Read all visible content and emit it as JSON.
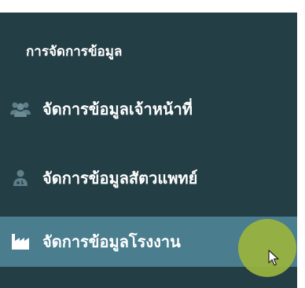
{
  "sidebar": {
    "section_label": "การจัดการข้อมูล",
    "items": [
      {
        "label": "จัดการข้อมูลเจ้าหน้าที่",
        "icon": "users-icon",
        "active": false
      },
      {
        "label": "จัดการข้อมูลสัตวแพทย์",
        "icon": "user-md-icon",
        "active": false
      },
      {
        "label": "จัดการข้อมูลโรงงาน",
        "icon": "factory-icon",
        "active": true
      }
    ]
  },
  "colors": {
    "sidebar_bg": "#243e46",
    "active_bg": "#4a7d8e",
    "text": "#ffffff",
    "icon_muted": "#5e7f88",
    "click_indicator": "#9ab43e"
  }
}
